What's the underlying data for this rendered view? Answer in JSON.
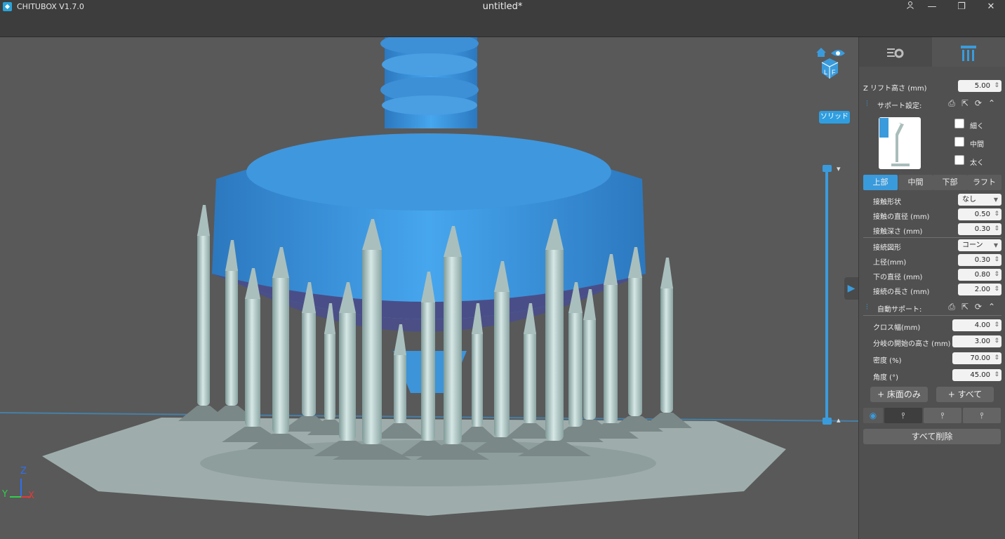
{
  "app": {
    "name": "CHITUBOX V1.7.0",
    "title": "untitled*"
  },
  "window_controls": {
    "user": "user-icon",
    "minimize": "—",
    "restore": "❐",
    "close": "✕"
  },
  "viewport": {
    "mode_label": "ソリッド",
    "axis_z": "Z",
    "axis_y": "Y",
    "axis_x": "X",
    "view_cube_letters": [
      "L",
      "F"
    ]
  },
  "panel": {
    "z_lift": {
      "label": "Z リフト高さ (mm)",
      "value": "5.00"
    },
    "support_settings": {
      "title": "サポート設定:"
    },
    "density_options": [
      "細く",
      "中間",
      "太く"
    ],
    "subtabs": [
      "上部",
      "中間",
      "下部",
      "ラフト"
    ],
    "top_params": [
      {
        "label": "接触形状",
        "value": "なし",
        "type": "select"
      },
      {
        "label": "接触の直径 (mm)",
        "value": "0.50",
        "type": "spin"
      },
      {
        "label": "接触深さ (mm)",
        "value": "0.30",
        "type": "spin"
      },
      {
        "label": "接続図形",
        "value": "コーン",
        "type": "select"
      },
      {
        "label": "上径(mm)",
        "value": "0.30",
        "type": "spin"
      },
      {
        "label": "下の直径 (mm)",
        "value": "0.80",
        "type": "spin"
      },
      {
        "label": "接続の長さ (mm)",
        "value": "2.00",
        "type": "spin"
      }
    ],
    "auto_support": {
      "title": "自動サポート:"
    },
    "auto_params": [
      {
        "label": "クロス幅(mm)",
        "value": "4.00"
      },
      {
        "label": "分岐の開始の高さ (mm)",
        "value": "3.00"
      },
      {
        "label": "密度 (%)",
        "value": "70.00"
      },
      {
        "label": "角度 (°)",
        "value": "45.00"
      }
    ],
    "buttons": {
      "floor_only": "+ 床面のみ",
      "all": "+ すべて",
      "delete_all": "すべて削除"
    }
  },
  "colors": {
    "accent": "#3a9bdc",
    "model": "#3d94d9",
    "support": "#b3ccc9",
    "background": "#595959"
  }
}
